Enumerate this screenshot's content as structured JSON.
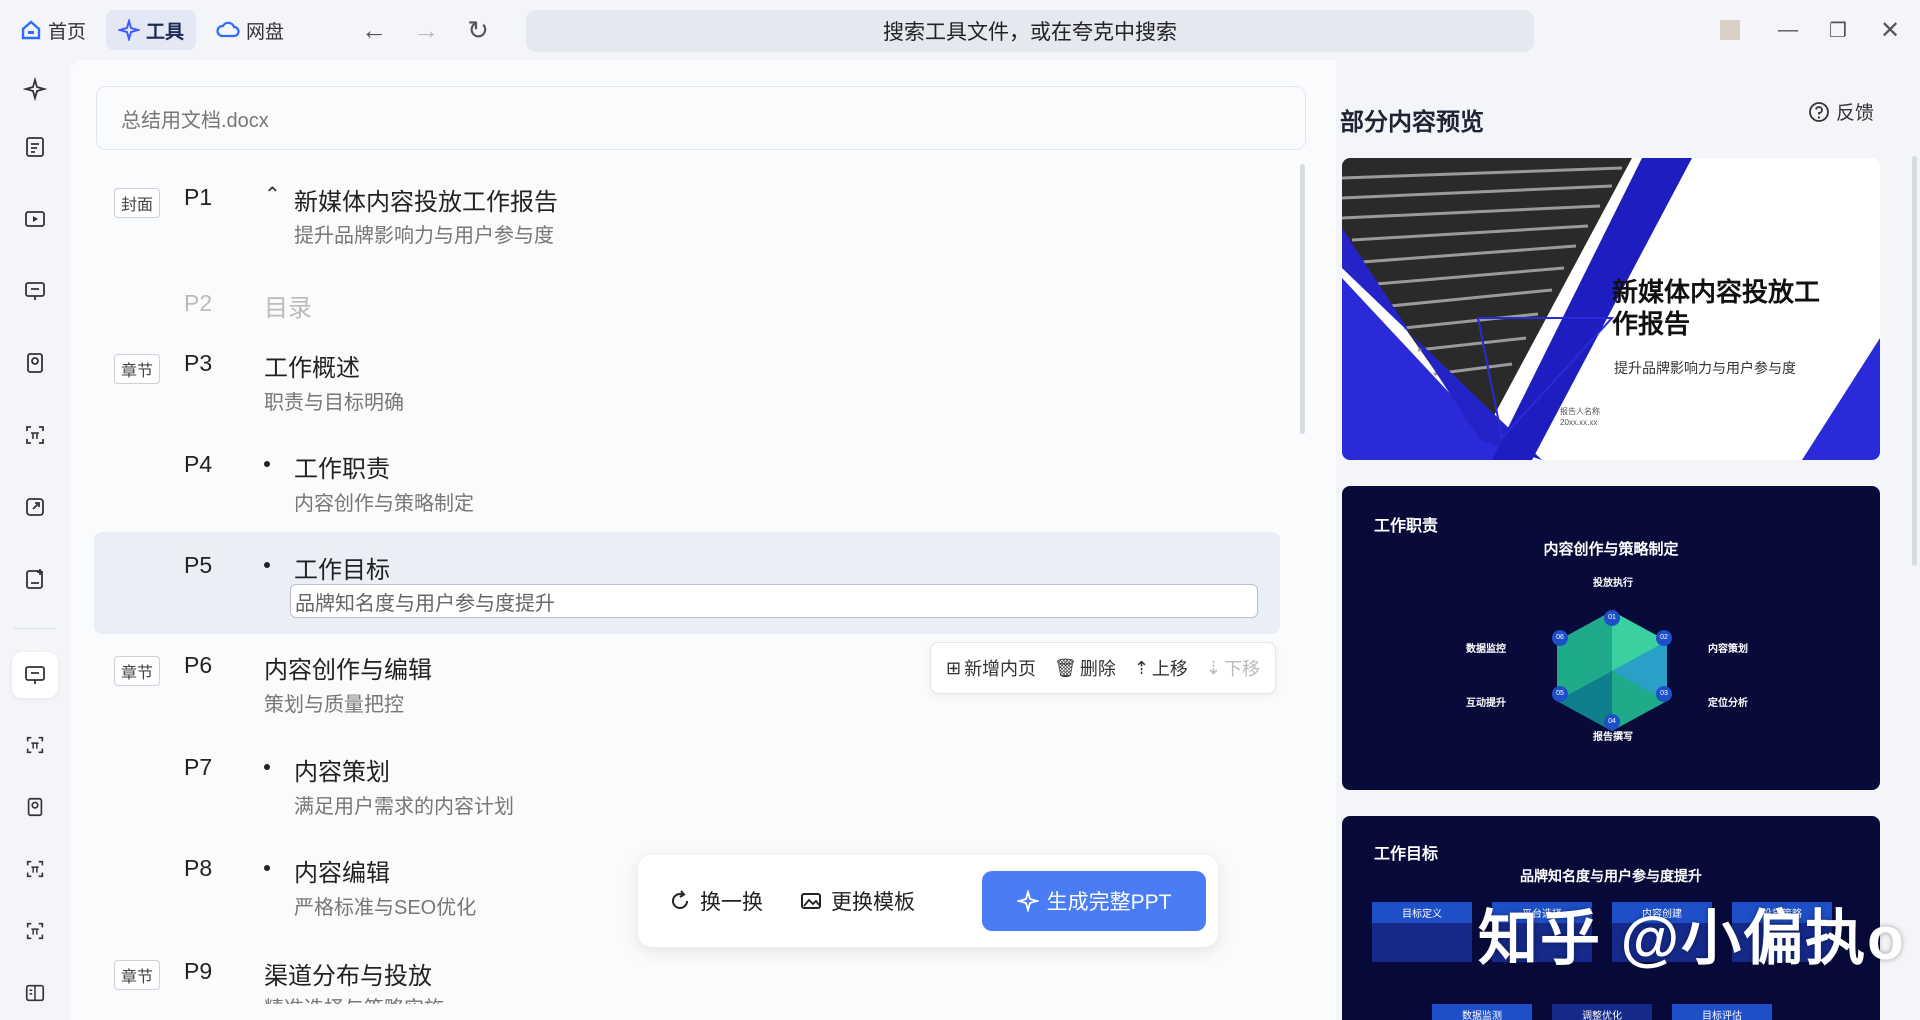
{
  "nav": {
    "home_label": "首页",
    "tools_label": "工具",
    "cloud_label": "网盘",
    "search_placeholder": "搜索工具文件，或在夸克中搜索"
  },
  "document": {
    "filename": "总结用文档.docx"
  },
  "outline": [
    {
      "tag": "封面",
      "page": "P1",
      "title": "新媒体内容投放工作报告",
      "subtitle": "提升品牌影响力与用户参与度"
    },
    {
      "tag": "",
      "page": "P2",
      "title": "目录",
      "subtitle": ""
    },
    {
      "tag": "章节",
      "page": "P3",
      "title": "工作概述",
      "subtitle": "职责与目标明确"
    },
    {
      "tag": "",
      "page": "P4",
      "title": "工作职责",
      "subtitle": "内容创作与策略制定"
    },
    {
      "tag": "",
      "page": "P5",
      "title": "工作目标",
      "subtitle": "品牌知名度与用户参与度提升"
    },
    {
      "tag": "章节",
      "page": "P6",
      "title": "内容创作与编辑",
      "subtitle": "策划与质量把控"
    },
    {
      "tag": "",
      "page": "P7",
      "title": "内容策划",
      "subtitle": "满足用户需求的内容计划"
    },
    {
      "tag": "",
      "page": "P8",
      "title": "内容编辑",
      "subtitle": "严格标准与SEO优化"
    },
    {
      "tag": "章节",
      "page": "P9",
      "title": "渠道分布与投放",
      "subtitle": "精准选择与策略实施"
    }
  ],
  "row_actions": {
    "add_page": "新增内页",
    "delete": "删除",
    "move_up": "上移",
    "move_down": "下移"
  },
  "bottom": {
    "swap_label": "换一换",
    "template_label": "更换模板",
    "generate_label": "生成完整PPT"
  },
  "preview": {
    "title": "部分内容预览",
    "feedback_label": "反馈",
    "slide1": {
      "title": "新媒体内容投放工作报告",
      "subtitle": "提升品牌影响力与用户参与度",
      "reporter": "报告人名称",
      "date": "20xx.xx.xx"
    },
    "slide2": {
      "heading": "工作职责",
      "center_title": "内容创作与策略制定",
      "nodes": [
        "投放执行",
        "内容策划",
        "定位分析",
        "报告撰写",
        "互动提升",
        "数据监控"
      ],
      "numbers": [
        "01",
        "02",
        "03",
        "04",
        "05",
        "06"
      ]
    },
    "slide3": {
      "heading": "工作目标",
      "center_title": "品牌知名度与用户参与度提升",
      "cards": [
        "目标定义",
        "平台选择",
        "内容创建",
        "投放策略"
      ],
      "bottom": [
        "数据监测",
        "调整优化",
        "目标评估"
      ]
    }
  },
  "watermark": "知乎 @小偏执o"
}
